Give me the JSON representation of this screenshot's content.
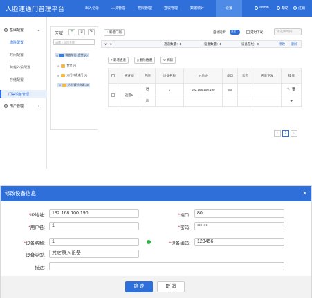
{
  "app": {
    "title": "人脸速通门管理平台",
    "nav": [
      "出入记录",
      "人员管理",
      "权限管理",
      "签收管理",
      "数据统计",
      "设置"
    ],
    "user": "admin",
    "help": "帮助",
    "logout": "注销"
  },
  "sidebar": {
    "group1": "基础配置",
    "items": [
      "场院配置",
      "时间配置",
      "跨越外设配置",
      "存储配置"
    ],
    "device_menu": "门禁设备管理",
    "group2": "用户管理"
  },
  "tree": {
    "title": "区域",
    "search_placeholder": "请输入区域名称",
    "nodes": [
      "微信单位1会堂 (2)",
      "食堂 (0)",
      "大门口通道门 (1)",
      "人脸通过终端 (3)"
    ]
  },
  "main": {
    "add_gate": "新增门岗",
    "auto_sync": "自动同步",
    "toggle_label": "开启",
    "timed_push": "定时下发",
    "time_placeholder": "请选择时间",
    "info_index": "1",
    "channel_count": "通道数量：1",
    "device_count": "设备数量：1",
    "online_count": "设备在线：0",
    "edit": "修改",
    "delete": "删除",
    "add_channel": "新增通道",
    "delete_channel": "删除通道",
    "refresh": "刷新",
    "table": {
      "headers": [
        "",
        "通道号",
        "方向",
        "设备名称",
        "IP地址",
        "端口",
        "状态",
        "名单下发",
        "操作"
      ],
      "rows": [
        {
          "channel": "通道1",
          "direction": "进",
          "name": "1",
          "ip": "192.168.100.190",
          "port": "80",
          "status": "",
          "list": ""
        },
        {
          "direction": "出"
        }
      ]
    },
    "page": "1"
  },
  "dialog": {
    "title": "修改设备信息",
    "fields": {
      "ip_label": "IP地址:",
      "ip": "192.168.100.190",
      "port_label": "端口:",
      "port": "80",
      "user_label": "用户名:",
      "user": "1",
      "pwd_label": "密码:",
      "pwd": "••••••",
      "devname_label": "设备名称:",
      "devname": "1",
      "devcode_label": "设备编码:",
      "devcode": "123456",
      "devtype_label": "设备类型:",
      "devtype": "其它录入设备",
      "desc_label": "描述:",
      "desc": ""
    },
    "ok": "确 定",
    "cancel": "取 消"
  }
}
